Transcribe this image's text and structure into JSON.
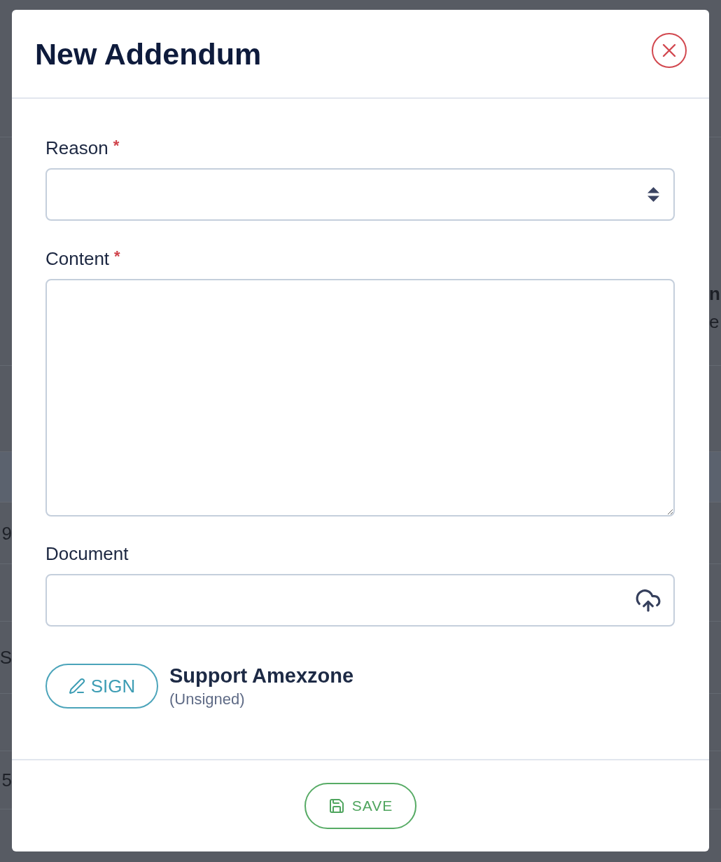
{
  "background_page": {
    "left_edge_texts": [
      {
        "text": "9",
        "bold": false
      },
      {
        "text": "S",
        "bold": false
      },
      {
        "text": "5",
        "bold": false
      }
    ],
    "right_edge_texts": [
      {
        "text": "n",
        "bold": true
      },
      {
        "text": "e",
        "bold": false
      }
    ]
  },
  "dialog": {
    "title": "New Addendum"
  },
  "fields": [
    {
      "kind": "select",
      "label": "Reason",
      "required_mark": "*"
    },
    {
      "kind": "textarea",
      "label": "Content",
      "required_mark": "*"
    },
    {
      "kind": "file",
      "label": "Document"
    }
  ],
  "signature": {
    "button": "SIGN",
    "signer": "Support Amexzone",
    "status": "(Unsigned)"
  },
  "footer": {
    "button": "SAVE"
  }
}
